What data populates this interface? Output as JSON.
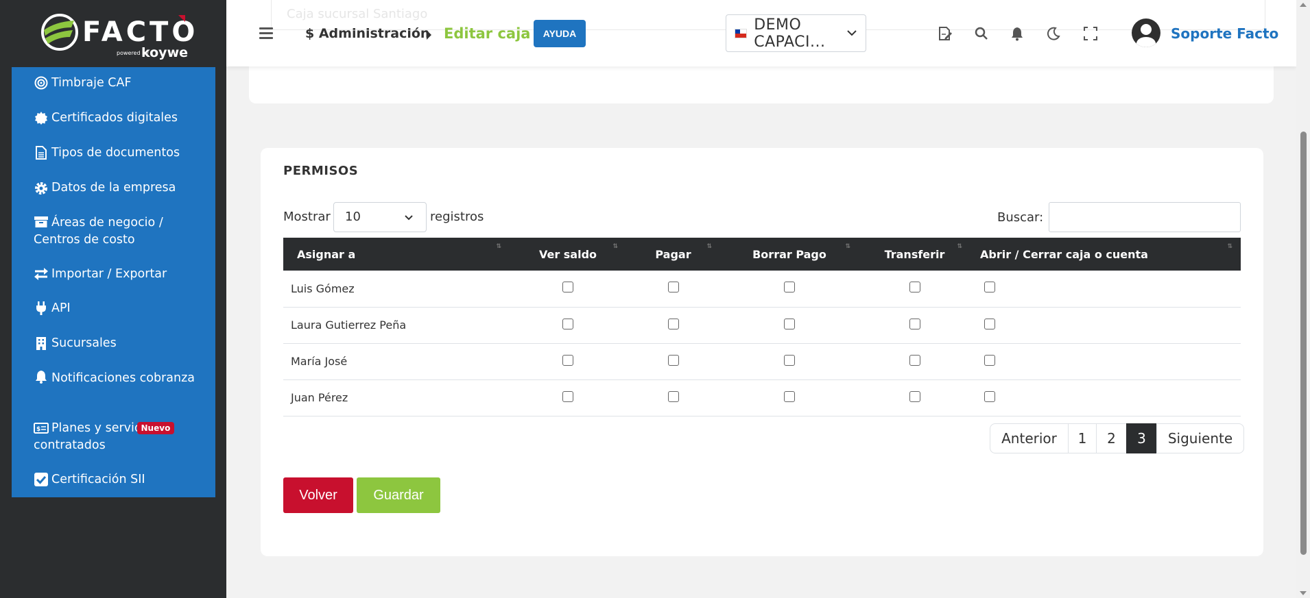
{
  "brand": {
    "logo_text": "FACTO",
    "powered_by": "powered by",
    "koywe": "koywe",
    "colors": {
      "green": "#8dc63f",
      "blue": "#1f74c0",
      "red": "#c8102e",
      "dark": "#2b2d2f"
    }
  },
  "sidebar": {
    "items": [
      {
        "label": "Timbraje CAF",
        "icon": "target-icon"
      },
      {
        "label": "Certificados digitales",
        "icon": "certificate-icon"
      },
      {
        "label": "Tipos de documentos",
        "icon": "document-icon"
      },
      {
        "label": "Datos de la empresa",
        "icon": "gear-icon"
      },
      {
        "label": "Áreas de negocio / Centros de costo",
        "icon": "archive-icon"
      },
      {
        "label": "Importar / Exportar",
        "icon": "exchange-icon"
      },
      {
        "label": "API",
        "icon": "plug-icon"
      },
      {
        "label": "Sucursales",
        "icon": "building-icon"
      },
      {
        "label": "Notificaciones cobranza",
        "icon": "bell-icon"
      },
      {
        "label": "Planes y servic",
        "label_cont": "contratados",
        "badge": "Nuevo",
        "icon": "money-card-icon"
      },
      {
        "label": "Certificación SII",
        "icon": "check-square-icon"
      }
    ]
  },
  "header": {
    "ghost_value": "Caja sucursal Santiago",
    "breadcrumb_parent": "$ Administración",
    "breadcrumb_current": "Editar caja",
    "help_label": "AYUDA",
    "company": "DEMO CAPACI...",
    "user_name": "Soporte Facto"
  },
  "permisos": {
    "title": "PERMISOS",
    "show_label": "Mostrar",
    "show_value": "10",
    "records_label": "registros",
    "search_label": "Buscar:",
    "search_value": "",
    "columns": [
      "Asignar a",
      "Ver saldo",
      "Pagar",
      "Borrar Pago",
      "Transferir",
      "Abrir / Cerrar caja o cuenta"
    ],
    "rows": [
      {
        "name": "Luis Gómez",
        "perms": [
          false,
          false,
          false,
          false,
          false
        ]
      },
      {
        "name": "Laura Gutierrez Peña",
        "perms": [
          false,
          false,
          false,
          false,
          false
        ]
      },
      {
        "name": "María José",
        "perms": [
          false,
          false,
          false,
          false,
          false
        ]
      },
      {
        "name": "Juan Pérez",
        "perms": [
          false,
          false,
          false,
          false,
          false
        ]
      }
    ],
    "pagination": {
      "prev": "Anterior",
      "pages": [
        "1",
        "2",
        "3"
      ],
      "active": "3",
      "next": "Siguiente"
    }
  },
  "actions": {
    "back": "Volver",
    "save": "Guardar"
  }
}
